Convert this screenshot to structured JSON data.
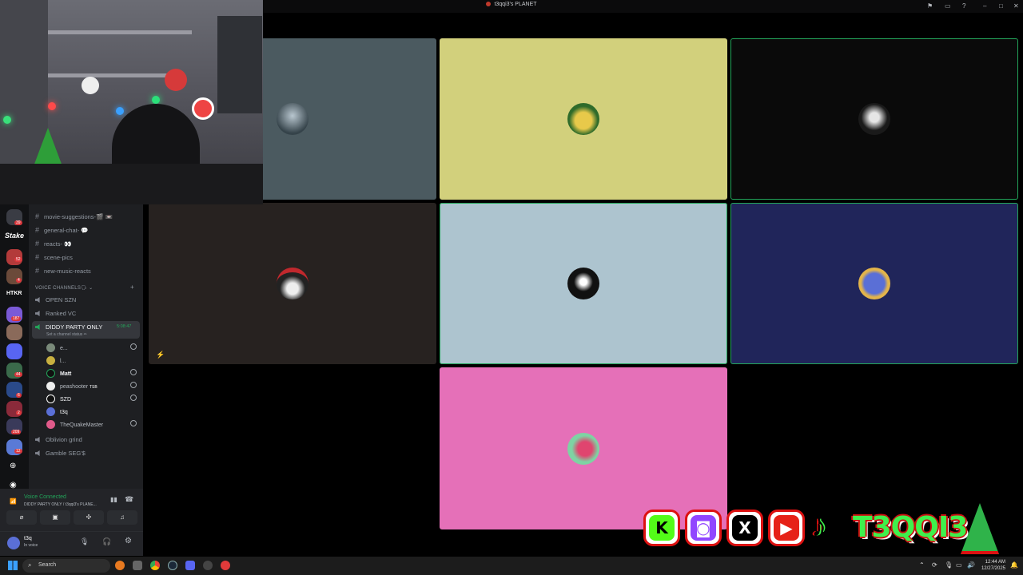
{
  "window": {
    "title": "t3qqi3's PLANET"
  },
  "sidebar": {
    "text_channels": [
      {
        "name": "movie-suggestions-🎬 📼"
      },
      {
        "name": "general-chat- 💬"
      },
      {
        "name": "reacts- 👀"
      },
      {
        "name": "scene-pics"
      },
      {
        "name": "new-music-reacts"
      }
    ],
    "voice_category": "VOICE CHANNELS🗣",
    "voice_channels": [
      {
        "name": "OPEN SZN"
      },
      {
        "name": "Ranked VC"
      },
      {
        "name": "DIDDY PARTY ONLY",
        "timer": "5:08:47",
        "status": "Set a channel status ✏"
      },
      {
        "name": "Oblivion grind"
      },
      {
        "name": "Gamble SEG'$"
      }
    ],
    "members": [
      {
        "name": "e..."
      },
      {
        "name": "l..."
      },
      {
        "name": "Matt"
      },
      {
        "name": "peashooter",
        "tag": "TSB"
      },
      {
        "name": "SZD"
      },
      {
        "name": "t3q"
      },
      {
        "name": "TheQuakeMaster"
      }
    ],
    "server_badges": [
      "39",
      "52",
      "4",
      "187",
      "44",
      "6",
      "2",
      "209",
      "12"
    ],
    "server_name_stake": "Stake",
    "server_name_htkr": "HTKR"
  },
  "voice_panel": {
    "status": "Voice Connected",
    "channel": "DIDDY PARTY ONLY / t3qqi3's PLANE..."
  },
  "user_panel": {
    "username": "t3q",
    "status": "In voice"
  },
  "socials": {
    "handle": "T3QQI3"
  },
  "taskbar": {
    "search_placeholder": "Search",
    "time": "12:44 AM",
    "date": "12/27/2025"
  },
  "colors": {
    "tile1": "#4b5a60",
    "tile2": "#d2d07c",
    "tile3": "#0a0a0a",
    "tile4": "#272220",
    "tile5": "#adc4cf",
    "tile6": "#20255a",
    "tile7": "#e570b8",
    "speaking": "#23a55a"
  }
}
